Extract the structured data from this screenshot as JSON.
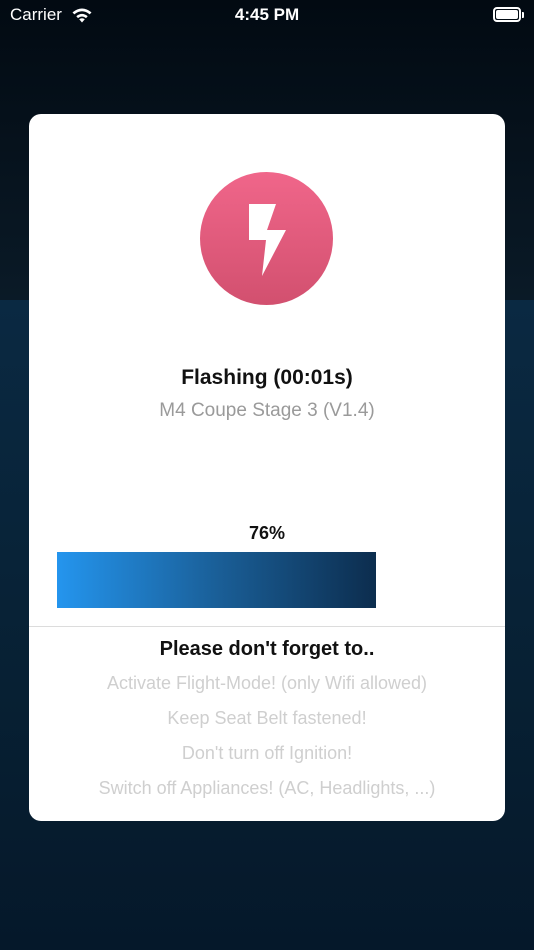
{
  "status_bar": {
    "carrier": "Carrier",
    "time": "4:45 PM",
    "wifi_icon": "wifi-icon",
    "battery_icon": "battery-icon"
  },
  "dialog": {
    "icon": "lightning-bolt-icon",
    "icon_color": "#e35b7e",
    "title": "Flashing (00:01s)",
    "subtitle": "M4 Coupe Stage 3 (V1.4)",
    "progress": {
      "percent_label": "76%",
      "value": 0.76,
      "gradient_start": "#2495ee",
      "gradient_end": "#0c2d4e"
    },
    "reminders": {
      "heading": "Please don't forget to..",
      "items": [
        "Activate Flight-Mode! (only Wifi allowed)",
        "Keep Seat Belt fastened!",
        "Don't turn off Ignition!",
        "Switch off Appliances! (AC, Headlights, ...)"
      ]
    }
  }
}
